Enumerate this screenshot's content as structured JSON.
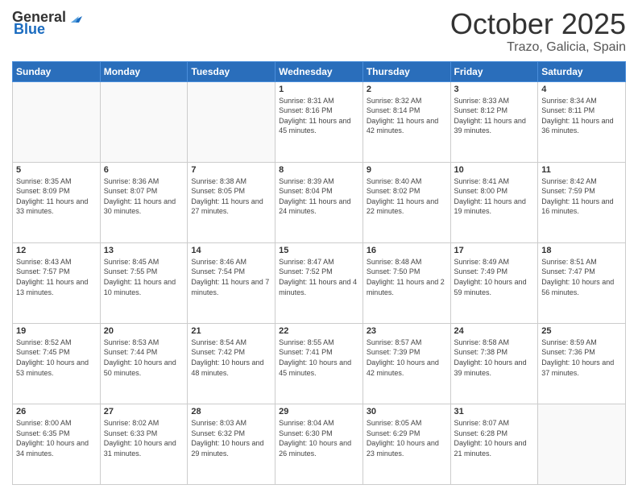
{
  "header": {
    "logo_general": "General",
    "logo_blue": "Blue",
    "month": "October 2025",
    "location": "Trazo, Galicia, Spain"
  },
  "days_of_week": [
    "Sunday",
    "Monday",
    "Tuesday",
    "Wednesday",
    "Thursday",
    "Friday",
    "Saturday"
  ],
  "weeks": [
    [
      {
        "day": "",
        "info": ""
      },
      {
        "day": "",
        "info": ""
      },
      {
        "day": "",
        "info": ""
      },
      {
        "day": "1",
        "info": "Sunrise: 8:31 AM\nSunset: 8:16 PM\nDaylight: 11 hours and 45 minutes."
      },
      {
        "day": "2",
        "info": "Sunrise: 8:32 AM\nSunset: 8:14 PM\nDaylight: 11 hours and 42 minutes."
      },
      {
        "day": "3",
        "info": "Sunrise: 8:33 AM\nSunset: 8:12 PM\nDaylight: 11 hours and 39 minutes."
      },
      {
        "day": "4",
        "info": "Sunrise: 8:34 AM\nSunset: 8:11 PM\nDaylight: 11 hours and 36 minutes."
      }
    ],
    [
      {
        "day": "5",
        "info": "Sunrise: 8:35 AM\nSunset: 8:09 PM\nDaylight: 11 hours and 33 minutes."
      },
      {
        "day": "6",
        "info": "Sunrise: 8:36 AM\nSunset: 8:07 PM\nDaylight: 11 hours and 30 minutes."
      },
      {
        "day": "7",
        "info": "Sunrise: 8:38 AM\nSunset: 8:05 PM\nDaylight: 11 hours and 27 minutes."
      },
      {
        "day": "8",
        "info": "Sunrise: 8:39 AM\nSunset: 8:04 PM\nDaylight: 11 hours and 24 minutes."
      },
      {
        "day": "9",
        "info": "Sunrise: 8:40 AM\nSunset: 8:02 PM\nDaylight: 11 hours and 22 minutes."
      },
      {
        "day": "10",
        "info": "Sunrise: 8:41 AM\nSunset: 8:00 PM\nDaylight: 11 hours and 19 minutes."
      },
      {
        "day": "11",
        "info": "Sunrise: 8:42 AM\nSunset: 7:59 PM\nDaylight: 11 hours and 16 minutes."
      }
    ],
    [
      {
        "day": "12",
        "info": "Sunrise: 8:43 AM\nSunset: 7:57 PM\nDaylight: 11 hours and 13 minutes."
      },
      {
        "day": "13",
        "info": "Sunrise: 8:45 AM\nSunset: 7:55 PM\nDaylight: 11 hours and 10 minutes."
      },
      {
        "day": "14",
        "info": "Sunrise: 8:46 AM\nSunset: 7:54 PM\nDaylight: 11 hours and 7 minutes."
      },
      {
        "day": "15",
        "info": "Sunrise: 8:47 AM\nSunset: 7:52 PM\nDaylight: 11 hours and 4 minutes."
      },
      {
        "day": "16",
        "info": "Sunrise: 8:48 AM\nSunset: 7:50 PM\nDaylight: 11 hours and 2 minutes."
      },
      {
        "day": "17",
        "info": "Sunrise: 8:49 AM\nSunset: 7:49 PM\nDaylight: 10 hours and 59 minutes."
      },
      {
        "day": "18",
        "info": "Sunrise: 8:51 AM\nSunset: 7:47 PM\nDaylight: 10 hours and 56 minutes."
      }
    ],
    [
      {
        "day": "19",
        "info": "Sunrise: 8:52 AM\nSunset: 7:45 PM\nDaylight: 10 hours and 53 minutes."
      },
      {
        "day": "20",
        "info": "Sunrise: 8:53 AM\nSunset: 7:44 PM\nDaylight: 10 hours and 50 minutes."
      },
      {
        "day": "21",
        "info": "Sunrise: 8:54 AM\nSunset: 7:42 PM\nDaylight: 10 hours and 48 minutes."
      },
      {
        "day": "22",
        "info": "Sunrise: 8:55 AM\nSunset: 7:41 PM\nDaylight: 10 hours and 45 minutes."
      },
      {
        "day": "23",
        "info": "Sunrise: 8:57 AM\nSunset: 7:39 PM\nDaylight: 10 hours and 42 minutes."
      },
      {
        "day": "24",
        "info": "Sunrise: 8:58 AM\nSunset: 7:38 PM\nDaylight: 10 hours and 39 minutes."
      },
      {
        "day": "25",
        "info": "Sunrise: 8:59 AM\nSunset: 7:36 PM\nDaylight: 10 hours and 37 minutes."
      }
    ],
    [
      {
        "day": "26",
        "info": "Sunrise: 8:00 AM\nSunset: 6:35 PM\nDaylight: 10 hours and 34 minutes."
      },
      {
        "day": "27",
        "info": "Sunrise: 8:02 AM\nSunset: 6:33 PM\nDaylight: 10 hours and 31 minutes."
      },
      {
        "day": "28",
        "info": "Sunrise: 8:03 AM\nSunset: 6:32 PM\nDaylight: 10 hours and 29 minutes."
      },
      {
        "day": "29",
        "info": "Sunrise: 8:04 AM\nSunset: 6:30 PM\nDaylight: 10 hours and 26 minutes."
      },
      {
        "day": "30",
        "info": "Sunrise: 8:05 AM\nSunset: 6:29 PM\nDaylight: 10 hours and 23 minutes."
      },
      {
        "day": "31",
        "info": "Sunrise: 8:07 AM\nSunset: 6:28 PM\nDaylight: 10 hours and 21 minutes."
      },
      {
        "day": "",
        "info": ""
      }
    ]
  ]
}
